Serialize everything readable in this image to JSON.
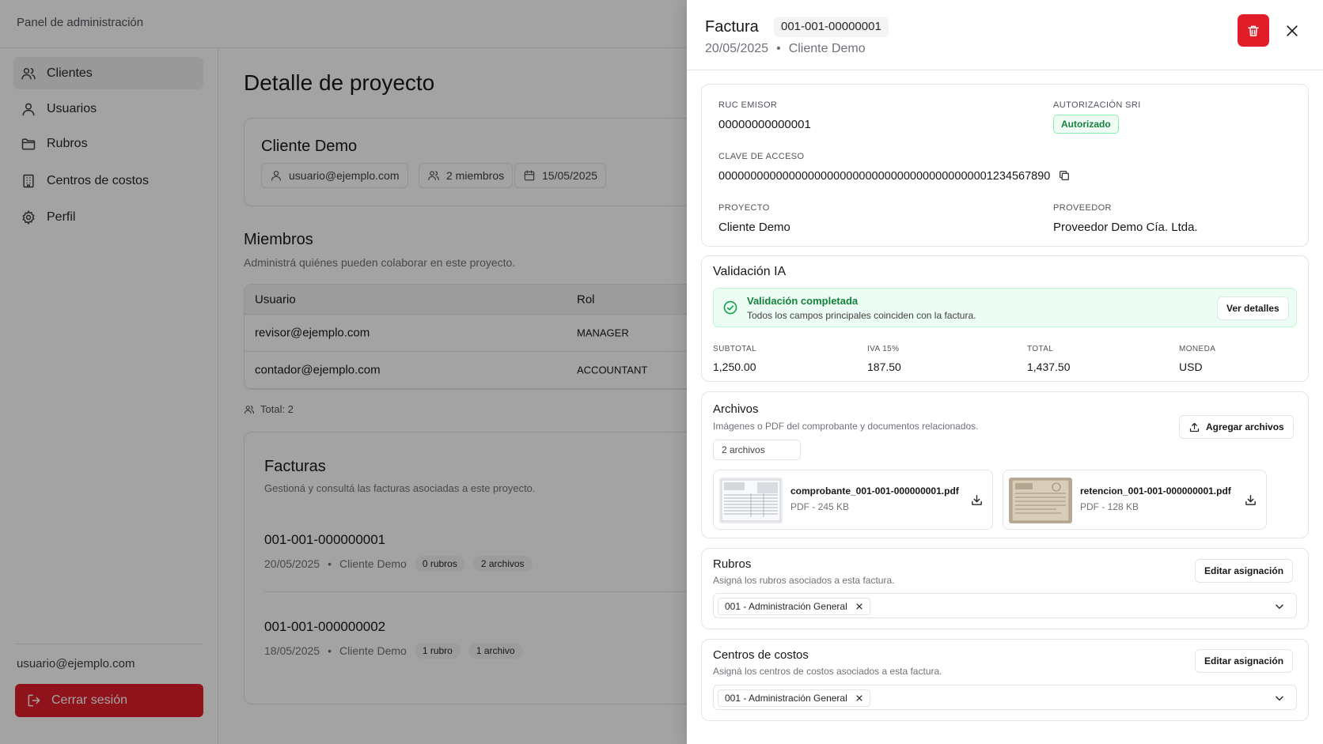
{
  "header": {
    "brand": "Panel de administración"
  },
  "sidebar": {
    "items": [
      {
        "label": "Clientes",
        "icon": "users-icon",
        "active": true
      },
      {
        "label": "Usuarios",
        "icon": "user-icon"
      },
      {
        "label": "Rubros",
        "icon": "folder-icon"
      },
      {
        "label": "Centros de costos",
        "icon": "building-icon"
      },
      {
        "label": "Perfil",
        "icon": "gear-icon"
      }
    ],
    "user_email": "usuario@ejemplo.com",
    "logout_label": "Cerrar sesión"
  },
  "main": {
    "title": "Detalle de proyecto",
    "client": {
      "name": "Cliente Demo",
      "owner": "usuario@ejemplo.com",
      "members": "2 miembros",
      "date": "15/05/2025"
    },
    "members_section": {
      "title": "Miembros",
      "subtitle": "Administrá quiénes pueden colaborar en este proyecto.",
      "columns": [
        "Usuario",
        "Rol"
      ],
      "rows": [
        {
          "user": "revisor@ejemplo.com",
          "role": "MANAGER"
        },
        {
          "user": "contador@ejemplo.com",
          "role": "ACCOUNTANT"
        }
      ],
      "total": "Total: 2"
    },
    "invoices_section": {
      "title": "Facturas",
      "subtitle": "Gestioná y consultá las facturas asociadas a este proyecto.",
      "items": [
        {
          "number": "001-001-000000001",
          "date": "20/05/2025",
          "client": "Cliente Demo",
          "rubros": "0 rubros",
          "archivos": "2 archivos"
        },
        {
          "number": "001-001-000000002",
          "date": "18/05/2025",
          "client": "Cliente Demo",
          "rubros": "1 rubro",
          "archivos": "1 archivo"
        }
      ]
    }
  },
  "drawer": {
    "title": "Factura",
    "number": "001-001-00000001",
    "date": "20/05/2025",
    "separator": "•",
    "client": "Cliente Demo",
    "details": {
      "ruc_label": "RUC EMISOR",
      "ruc_value": "00000000000001",
      "auth_label": "AUTORIZACIÓN SRI",
      "auth_value": "Autorizado",
      "key_label": "CLAVE DE ACCESO",
      "key_value": "0000000000000000000000000000000000000000001234567890",
      "project_label": "PROYECTO",
      "project_value": "Cliente Demo",
      "provider_label": "PROVEEDOR",
      "provider_value": "Proveedor Demo Cía. Ltda."
    },
    "ia": {
      "title": "Validación IA",
      "status_title": "Validación completada",
      "status_text": "Todos los campos principales coinciden con la factura.",
      "details_button": "Ver detalles",
      "totals": [
        {
          "label": "SUBTOTAL",
          "value": "1,250.00"
        },
        {
          "label": "IVA 15%",
          "value": "187.50"
        },
        {
          "label": "TOTAL",
          "value": "1,437.50"
        },
        {
          "label": "MONEDA",
          "value": "USD"
        }
      ]
    },
    "files": {
      "title": "Archivos",
      "subtitle": "Imágenes o PDF del comprobante y documentos relacionados.",
      "add_button": "Agregar archivos",
      "count": "2 archivos",
      "items": [
        {
          "name": "comprobante_001-001-000000001.pdf",
          "meta": "PDF - 245 KB"
        },
        {
          "name": "retencion_001-001-000000001.pdf",
          "meta": "PDF - 128 KB"
        }
      ]
    },
    "rubros": {
      "title": "Rubros",
      "subtitle": "Asigná los rubros asociados a esta factura.",
      "edit_button": "Editar asignación",
      "tag": "001 - Administración General"
    },
    "centros": {
      "title": "Centros de costos",
      "subtitle": "Asigná los centros de costos asociados a esta factura.",
      "edit_button": "Editar asignación",
      "tag": "001 - Administración General"
    }
  },
  "colors": {
    "danger": "#e11d2a",
    "success": "#15803d",
    "overlay": "rgba(0,0,0,0.36)"
  }
}
